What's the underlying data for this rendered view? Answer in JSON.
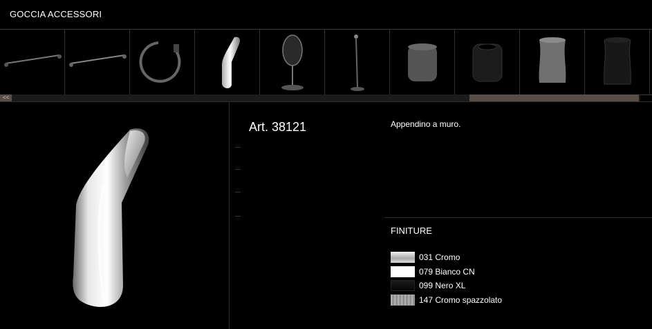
{
  "header": {
    "title": "GOCCIA ACCESSORI"
  },
  "carousel": {
    "items": [
      {
        "icon": "towel-bar-icon"
      },
      {
        "icon": "towel-bar-icon"
      },
      {
        "icon": "towel-ring-icon"
      },
      {
        "icon": "wall-hook-icon"
      },
      {
        "icon": "standing-mirror-icon"
      },
      {
        "icon": "floor-stand-icon"
      },
      {
        "icon": "grey-container-icon"
      },
      {
        "icon": "black-container-icon"
      },
      {
        "icon": "grey-vase-icon"
      },
      {
        "icon": "black-vase-icon"
      }
    ],
    "scroll_prev_label": "<<",
    "scroll_position": 0.73
  },
  "product": {
    "article": "Art. 38121",
    "description": "Appendino a muro.",
    "image_icon": "wall-hook-icon"
  },
  "finishes": {
    "title": "FINITURE",
    "items": [
      {
        "label": "031 Cromo",
        "color": "#d9d9d9"
      },
      {
        "label": "079 Bianco CN",
        "color": "#ffffff"
      },
      {
        "label": "099 Nero XL",
        "color": "#111111"
      },
      {
        "label": "147 Cromo spazzolato",
        "color": "#8c8c8c"
      }
    ]
  },
  "colors": {
    "accent": "#5a4e44",
    "background": "#000000"
  }
}
